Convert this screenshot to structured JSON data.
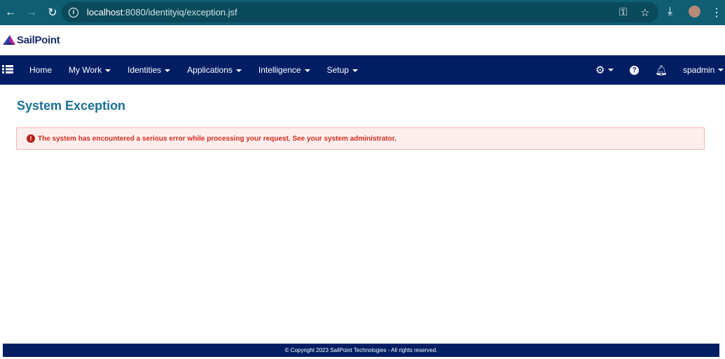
{
  "browser": {
    "url_host": "localhost",
    "url_rest": ":8080/identityiq/exception.jsf"
  },
  "brand": {
    "name": "SailPoint"
  },
  "nav": {
    "items": [
      {
        "label": "Home",
        "dropdown": false
      },
      {
        "label": "My Work",
        "dropdown": true
      },
      {
        "label": "Identities",
        "dropdown": true
      },
      {
        "label": "Applications",
        "dropdown": true
      },
      {
        "label": "Intelligence",
        "dropdown": true
      },
      {
        "label": "Setup",
        "dropdown": true
      }
    ],
    "user": "spadmin"
  },
  "page": {
    "title": "System Exception",
    "error": "The system has encountered a serious error while processing your request. See your system administrator."
  },
  "footer": {
    "text": "© Copyright 2023 SailPoint Technologies - All rights reserved."
  }
}
